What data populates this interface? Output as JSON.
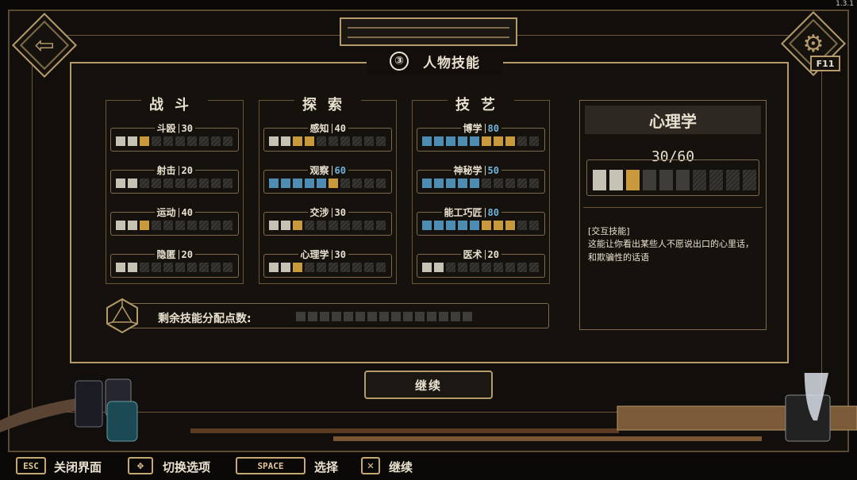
{
  "version": "1.3.1",
  "title": {
    "number": "③",
    "text": "人物技能"
  },
  "corner_buttons": {
    "back_icon": "arrow-left-icon",
    "settings_icon": "gear-icon",
    "settings_key": "F11"
  },
  "columns": [
    {
      "title": "战斗",
      "skills": [
        {
          "name": "斗殴",
          "value": "30",
          "pips": [
            "g",
            "g",
            "y",
            "h",
            "h",
            "h",
            "h",
            "h",
            "h",
            "h"
          ]
        },
        {
          "name": "射击",
          "value": "20",
          "pips": [
            "g",
            "g",
            "h",
            "h",
            "h",
            "h",
            "h",
            "h",
            "h",
            "h"
          ]
        },
        {
          "name": "运动",
          "value": "40",
          "pips": [
            "g",
            "g",
            "y",
            "h",
            "h",
            "h",
            "h",
            "h",
            "h",
            "h"
          ]
        },
        {
          "name": "隐匿",
          "value": "20",
          "pips": [
            "g",
            "g",
            "h",
            "h",
            "h",
            "h",
            "h",
            "h",
            "h",
            "h"
          ]
        }
      ]
    },
    {
      "title": "探索",
      "skills": [
        {
          "name": "感知",
          "value": "40",
          "pips": [
            "g",
            "g",
            "y",
            "y",
            "h",
            "h",
            "h",
            "h",
            "h",
            "h"
          ]
        },
        {
          "name": "观察",
          "value": "60",
          "pips": [
            "b",
            "b",
            "b",
            "b",
            "b",
            "y",
            "h",
            "h",
            "h",
            "h"
          ]
        },
        {
          "name": "交涉",
          "value": "30",
          "pips": [
            "g",
            "g",
            "y",
            "h",
            "h",
            "h",
            "h",
            "h",
            "h",
            "h"
          ]
        },
        {
          "name": "心理学",
          "value": "30",
          "pips": [
            "g",
            "g",
            "y",
            "h",
            "h",
            "h",
            "h",
            "h",
            "h",
            "h"
          ]
        }
      ]
    },
    {
      "title": "技艺",
      "skills": [
        {
          "name": "博学",
          "value": "80",
          "pips": [
            "b",
            "b",
            "b",
            "b",
            "b",
            "y",
            "y",
            "y",
            "h",
            "h"
          ]
        },
        {
          "name": "神秘学",
          "value": "50",
          "pips": [
            "b",
            "b",
            "b",
            "b",
            "b",
            "h",
            "h",
            "h",
            "h",
            "h"
          ]
        },
        {
          "name": "能工巧匠",
          "value": "80",
          "pips": [
            "b",
            "b",
            "b",
            "b",
            "b",
            "y",
            "y",
            "y",
            "h",
            "h"
          ]
        },
        {
          "name": "医术",
          "value": "20",
          "pips": [
            "g",
            "g",
            "h",
            "h",
            "h",
            "h",
            "h",
            "h",
            "h",
            "h"
          ]
        }
      ]
    }
  ],
  "detail": {
    "skill": "心理学",
    "score": "30/60",
    "pips": [
      "g",
      "g",
      "y",
      "d",
      "d",
      "d",
      "h",
      "h",
      "h",
      "h"
    ],
    "tag": "[交互技能]",
    "description": "这能让你看出某些人不愿说出口的心里话，和欺骗性的话语"
  },
  "remaining": {
    "label": "剩余技能分配点数:",
    "points_left": 0,
    "total_slots": 15
  },
  "continue_button": "继续",
  "footer": [
    {
      "key": "ESC",
      "label": "关闭界面"
    },
    {
      "key": "✥",
      "label": "切换选项"
    },
    {
      "key": "SPACE",
      "label": "选择"
    },
    {
      "key": "✕",
      "label": "继续"
    }
  ],
  "colors": {
    "gold": "#b59a6a",
    "blue": "#4d8db3",
    "yellow": "#c99a3c",
    "grey": "#c6c2b4"
  }
}
